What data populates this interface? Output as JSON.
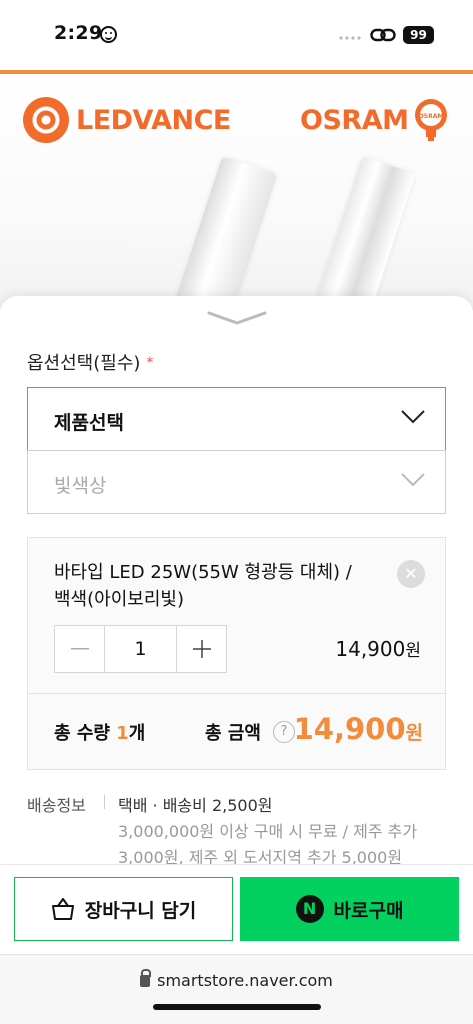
{
  "status_bar": {
    "time": "2:29",
    "battery": "99",
    "icons": [
      "smiley-icon",
      "signal-dots-icon",
      "link-icon",
      "battery-icon"
    ]
  },
  "banner": {
    "brand_left": "LEDVANCE",
    "brand_right": "OSRAM",
    "osram_badge": "OSRAM",
    "accent_color": "#f26b2a"
  },
  "options": {
    "title": "옵션선택(필수)",
    "required_mark": "*",
    "product_select": {
      "label": "제품선택"
    },
    "color_select": {
      "label": "빛색상"
    }
  },
  "selected_item": {
    "name": "바타입 LED 25W(55W 형광등 대체) / 백색(아이보리빛)",
    "quantity": "1",
    "price": "14,900",
    "price_unit": "원",
    "remove_icon": "close-icon"
  },
  "totals": {
    "qty_label": "총 수량",
    "qty_value": "1",
    "qty_unit": "개",
    "price_label": "총 금액",
    "help": "?",
    "price_value": "14,900",
    "price_unit": "원",
    "accent_color": "#f28b3c"
  },
  "shipping": {
    "label": "배송정보",
    "main": "택배 · 배송비 2,500원",
    "detail": "3,000,000원 이상 구매 시 무료 / 제주 추가 3,000원, 제주 외 도서지역 추가 5,000원"
  },
  "actions": {
    "cart_label": "장바구니 담기",
    "buy_label": "바로구매",
    "buy_badge": "N",
    "buy_color": "#03d15f"
  },
  "browser": {
    "url": "smartstore.naver.com"
  }
}
